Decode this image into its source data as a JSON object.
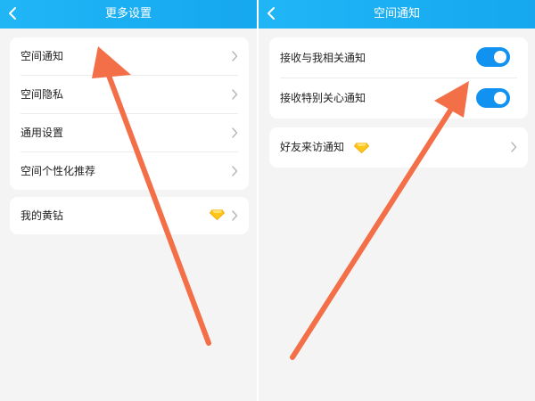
{
  "left_screen": {
    "title": "更多设置",
    "back_icon": "chevron-left-icon",
    "menu_items": [
      {
        "label": "空间通知"
      },
      {
        "label": "空间隐私"
      },
      {
        "label": "通用设置"
      },
      {
        "label": "空间个性化推荐"
      }
    ],
    "yellow_diamond_item": {
      "label": "我的黄钻",
      "icon": "yellow-diamond-icon"
    }
  },
  "right_screen": {
    "title": "空间通知",
    "back_icon": "chevron-left-icon",
    "toggles": [
      {
        "label": "接收与我相关通知",
        "enabled": true
      },
      {
        "label": "接收特别关心通知",
        "enabled": true
      }
    ],
    "visitor_notice": {
      "label": "好友来访通知",
      "icon": "yellow-diamond-icon"
    }
  },
  "colors": {
    "header_gradient_start": "#20b6f6",
    "header_gradient_end": "#16a7ef",
    "toggle_on": "#1192f0",
    "annotation_arrow": "#f36f48",
    "background": "#f4f4f4"
  }
}
